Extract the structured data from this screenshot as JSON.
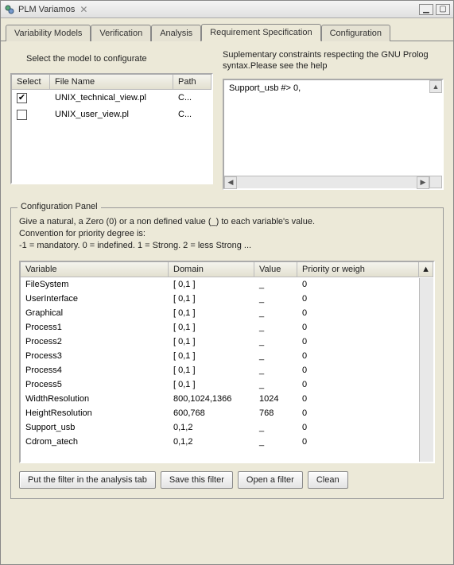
{
  "window": {
    "title": "PLM Variamos",
    "close_tab_glyph": "✕",
    "min_glyph": "▁",
    "max_glyph": "▢"
  },
  "tabs": [
    {
      "label": "Variability Models"
    },
    {
      "label": "Verification"
    },
    {
      "label": "Analysis"
    },
    {
      "label": "Requirement Specification"
    },
    {
      "label": "Configuration"
    }
  ],
  "model_section": {
    "label": "Select the model to configurate",
    "headers": {
      "select": "Select",
      "name": "File Name",
      "path": "Path"
    },
    "rows": [
      {
        "checked": true,
        "name": "UNIX_technical_view.pl",
        "path": "C..."
      },
      {
        "checked": false,
        "name": "UNIX_user_view.pl",
        "path": "C..."
      }
    ]
  },
  "constraints": {
    "label": "Suplementary constraints respecting the GNU Prolog syntax.Please see the help",
    "text": "Support_usb #> 0,"
  },
  "config_panel": {
    "legend": "Configuration Panel",
    "help1": "Give a natural, a Zero (0) or a non defined value (_) to each variable's value.",
    "help2": "Convention for priority degree is:",
    "help3": "-1 = mandatory. 0 = indefined. 1 = Strong. 2 = less Strong ...",
    "headers": {
      "var": "Variable",
      "dom": "Domain",
      "val": "Value",
      "pri": "Priority or weigh"
    },
    "rows": [
      {
        "var": "FileSystem",
        "dom": "[ 0,1 ]",
        "val": "_",
        "pri": "0"
      },
      {
        "var": "UserInterface",
        "dom": "[ 0,1 ]",
        "val": "_",
        "pri": "0"
      },
      {
        "var": "Graphical",
        "dom": "[ 0,1 ]",
        "val": "_",
        "pri": "0"
      },
      {
        "var": "Process1",
        "dom": "[ 0,1 ]",
        "val": "_",
        "pri": "0"
      },
      {
        "var": "Process2",
        "dom": "[ 0,1 ]",
        "val": "_",
        "pri": "0"
      },
      {
        "var": "Process3",
        "dom": "[ 0,1 ]",
        "val": "_",
        "pri": "0"
      },
      {
        "var": "Process4",
        "dom": "[ 0,1 ]",
        "val": "_",
        "pri": "0"
      },
      {
        "var": "Process5",
        "dom": "[ 0,1 ]",
        "val": "_",
        "pri": "0"
      },
      {
        "var": "WidthResolution",
        "dom": "800,1024,1366",
        "val": "1024",
        "pri": "0"
      },
      {
        "var": "HeightResolution",
        "dom": "600,768",
        "val": "768",
        "pri": "0"
      },
      {
        "var": "Support_usb",
        "dom": "0,1,2",
        "val": "_",
        "pri": "0"
      },
      {
        "var": "Cdrom_atech",
        "dom": "0,1,2",
        "val": "_",
        "pri": "0"
      }
    ]
  },
  "buttons": {
    "put_filter": "Put the filter in the analysis tab",
    "save_filter": "Save this filter",
    "open_filter": "Open a filter",
    "clean": "Clean"
  }
}
